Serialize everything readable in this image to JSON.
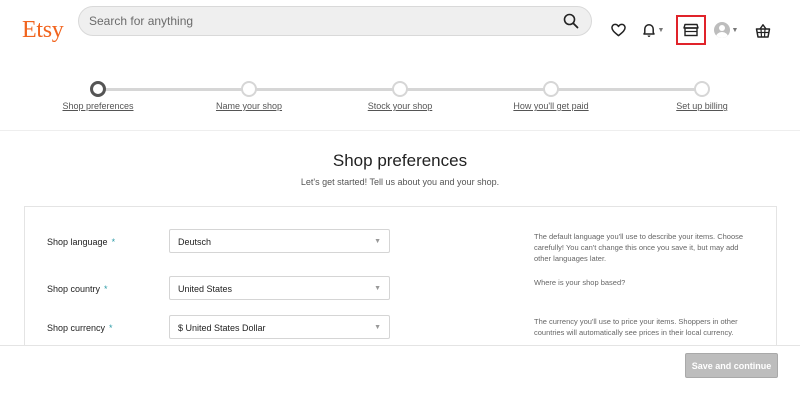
{
  "header": {
    "logo": "Etsy",
    "search_placeholder": "Search for anything",
    "icons": [
      "search-icon",
      "heart-icon",
      "bell-icon",
      "shop-manager-icon",
      "account-avatar-icon",
      "shopping-basket-icon"
    ],
    "highlight_color": "#e0232a",
    "brand_color": "#f1641e"
  },
  "stepper": {
    "steps": [
      {
        "label": "Shop preferences",
        "active": true
      },
      {
        "label": "Name your shop",
        "active": false
      },
      {
        "label": "Stock your shop",
        "active": false
      },
      {
        "label": "How you'll get paid",
        "active": false
      },
      {
        "label": "Set up billing",
        "active": false
      }
    ]
  },
  "page": {
    "title": "Shop preferences",
    "subtitle": "Let's get started! Tell us about you and your shop."
  },
  "form": {
    "rows": [
      {
        "label": "Shop language",
        "required": "*",
        "value": "Deutsch",
        "help": "The default language you'll use to describe your items. Choose carefully! You can't change this once you save it, but may add other languages later."
      },
      {
        "label": "Shop country",
        "required": "*",
        "value": "United States",
        "help": "Where is your shop based?"
      },
      {
        "label": "Shop currency",
        "required": "*",
        "value": "$ United States Dollar",
        "help": "The currency you'll use to price your items. Shoppers in other countries will automatically see prices in their local currency."
      }
    ],
    "required_color": "#2e9ca8"
  },
  "footer": {
    "save_label": "Save and continue"
  }
}
